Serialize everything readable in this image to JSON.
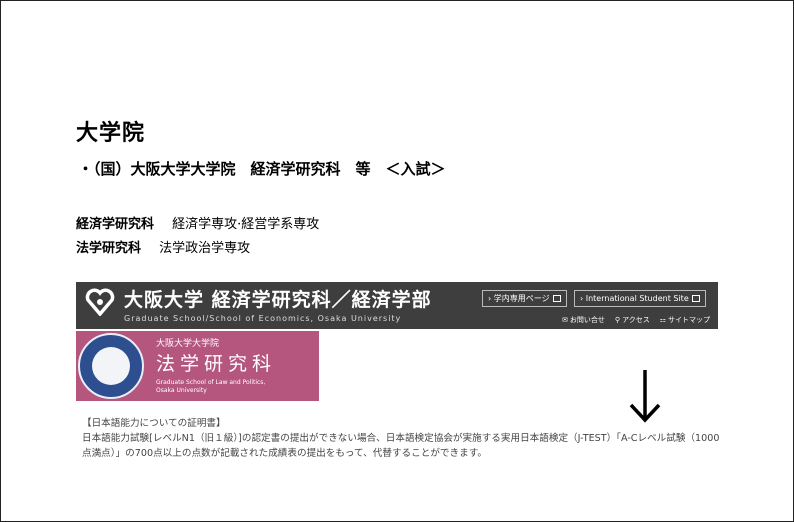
{
  "heading": "大学院",
  "subheading": "・（国）大阪大学大学院　経済学研究科　等　＜入試＞",
  "programs": [
    {
      "name": "経済学研究科",
      "desc": "経済学専攻·経営学系専攻"
    },
    {
      "name": "法学研究科",
      "desc": "法学政治学専攻"
    }
  ],
  "econ_banner": {
    "title": "大阪大学  経済学研究科／経済学部",
    "subtitle": "Graduate School/School of Economics, Osaka University",
    "btn_internal": "› 学内専用ページ",
    "btn_intl": "› International Student Site",
    "link_contact": "お問い合せ",
    "link_access": "アクセス",
    "link_sitemap": "サイトマップ"
  },
  "law_banner": {
    "small": "大阪大学大学院",
    "big": "法学研究科",
    "en_line1": "Graduate School of Law and Politics,",
    "en_line2": "Osaka University"
  },
  "note": {
    "title": "【日本語能力についての証明書】",
    "body": "日本語能力試験[レベルN1（旧１級）]の認定書の提出ができない場合、日本語検定協会が実施する実用日本語検定（J-TEST）「A-Cレベル試験（1000点満点）」の700点以上の点数が記載された成績表の提出をもって、代替することができます。"
  },
  "colors": {
    "econ_banner_bg": "#3e3e3e",
    "law_banner_bg": "#b5567f"
  }
}
